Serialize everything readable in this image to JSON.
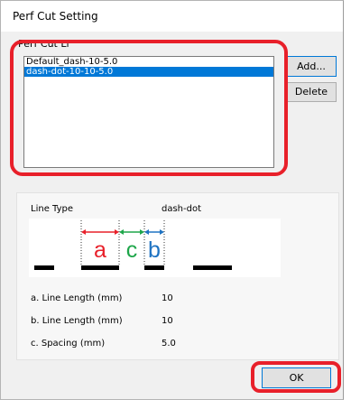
{
  "window": {
    "title": "Perf Cut Setting"
  },
  "group": {
    "label": "Perf Cut Li"
  },
  "list": {
    "items": [
      {
        "label": "Default_dash-10-5.0",
        "selected": false
      },
      {
        "label": "dash-dot-10-10-5.0",
        "selected": true
      }
    ]
  },
  "buttons": {
    "add": "Add...",
    "delete": "Delete",
    "ok": "OK"
  },
  "details": {
    "line_type_label": "Line Type",
    "line_type_value": "dash-dot",
    "line_length_a_label": "a. Line Length (mm)",
    "line_length_a_value": "10",
    "line_length_b_label": "b. Line Length (mm)",
    "line_length_b_value": "10",
    "spacing_label": "c. Spacing (mm)",
    "spacing_value": "5.0"
  },
  "diagram": {
    "label_a": "a",
    "label_c": "c",
    "label_b": "b",
    "color_a": "#e8202a",
    "color_c": "#1ea64a",
    "color_b": "#1f73c2"
  },
  "colors": {
    "highlight": "#e8202a",
    "selection": "#0078d7"
  }
}
